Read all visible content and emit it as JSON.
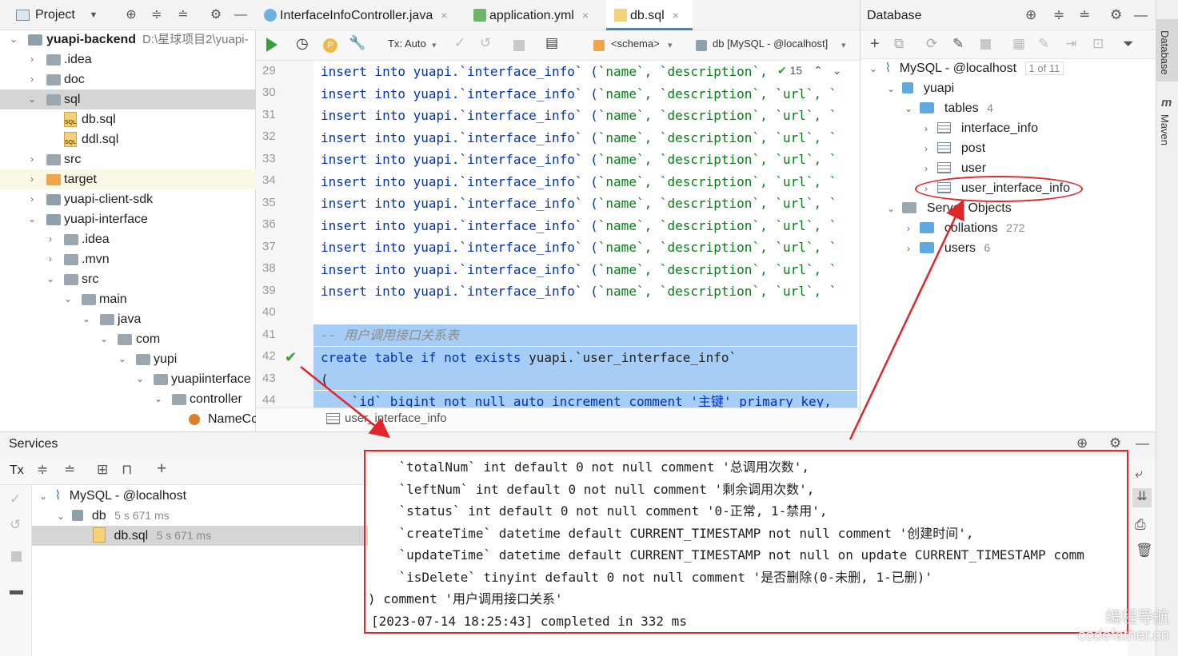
{
  "project": {
    "title": "Project",
    "items": [
      {
        "label": "yuapi-backend",
        "path": "D:\\星球项目2\\yuapi-"
      },
      {
        "label": ".idea"
      },
      {
        "label": "doc"
      },
      {
        "label": "sql"
      },
      {
        "label": "db.sql"
      },
      {
        "label": "ddl.sql"
      },
      {
        "label": "src"
      },
      {
        "label": "target"
      },
      {
        "label": "yuapi-client-sdk"
      },
      {
        "label": "yuapi-interface"
      },
      {
        "label": ".idea"
      },
      {
        "label": ".mvn"
      },
      {
        "label": "src"
      },
      {
        "label": "main"
      },
      {
        "label": "java"
      },
      {
        "label": "com"
      },
      {
        "label": "yupi"
      },
      {
        "label": "yuapiinterface"
      },
      {
        "label": "controller"
      },
      {
        "label": "NameCc"
      }
    ],
    "sql_icon_text": "SQL"
  },
  "editor": {
    "tabs": [
      {
        "label": "InterfaceInfoController.java"
      },
      {
        "label": "application.yml"
      },
      {
        "label": "db.sql"
      }
    ],
    "tab_close": "×",
    "toolbar": {
      "tx": "Tx: Auto",
      "schema": "<schema>",
      "datasource": "db [MySQL - @localhost]",
      "p_badge": "P"
    },
    "inspection_count": "15",
    "line_numbers": [
      "29",
      "30",
      "31",
      "32",
      "33",
      "34",
      "35",
      "36",
      "37",
      "38",
      "39",
      "40",
      "41",
      "42",
      "43",
      "44"
    ],
    "insert_line_prefix": "insert into yuapi.`interface_info` (",
    "insert_line_tail": "`name`, `description`, `url`, `",
    "comment_line": "-- 用户调用接口关系表",
    "create_line_kw": "create table if not exists ",
    "create_line_name": "yuapi.`user_interface_info`",
    "paren_line": "(",
    "id_line": "    `id` bigint not null auto_increment comment '主键' primary key,",
    "breadcrumb": "user_interface_info"
  },
  "database": {
    "title": "Database",
    "connection": "MySQL - @localhost",
    "connection_badge": "1 of 11",
    "schema": "yuapi",
    "tables_label": "tables",
    "tables_count": "4",
    "tables": [
      "interface_info",
      "post",
      "user",
      "user_interface_info"
    ],
    "server_objects": "Server Objects",
    "collations": "collations",
    "collations_count": "272",
    "users": "users",
    "users_count": "6"
  },
  "right_strip": {
    "database": "Database",
    "maven": "Maven"
  },
  "services": {
    "title": "Services",
    "tx": "Tx",
    "tree": [
      {
        "label": "MySQL - @localhost",
        "meta": ""
      },
      {
        "label": "db",
        "meta": "5 s 671 ms"
      },
      {
        "label": "db.sql",
        "meta": "5 s 671 ms"
      }
    ],
    "console": [
      "    `totalNum` int default 0 not null comment '总调用次数',",
      "    `leftNum` int default 0 not null comment '剩余调用次数',",
      "    `status` int default 0 not null comment '0-正常, 1-禁用',",
      "    `createTime` datetime default CURRENT_TIMESTAMP not null comment '创建时间',",
      "    `updateTime` datetime default CURRENT_TIMESTAMP not null on update CURRENT_TIMESTAMP comm",
      "    `isDelete` tinyint default 0 not null comment '是否删除(0-未删, 1-已删)'",
      ") comment '用户调用接口关系'",
      "[2023-07-14 18:25:43] completed in 332 ms"
    ]
  },
  "watermark": {
    "line1": "编程导航",
    "line2": "codefather.cn"
  },
  "colors": {
    "accent": "#4083c9",
    "annotation": "#e0262a",
    "keyword": "#0033b3",
    "string": "#067d17",
    "selection": "#a6cdf5"
  }
}
